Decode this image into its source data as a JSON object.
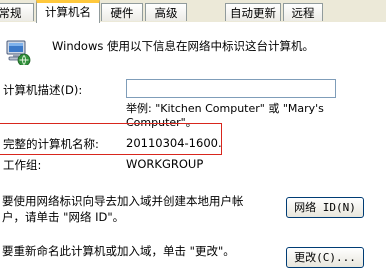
{
  "tabs": [
    {
      "label": "常规"
    },
    {
      "label": "计算机名"
    },
    {
      "label": "硬件"
    },
    {
      "label": "高级"
    },
    {
      "label": "自动更新"
    },
    {
      "label": "远程"
    }
  ],
  "icon": "computer-icon",
  "description": "Windows 使用以下信息在网络中标识这台计算机。",
  "computer_description": {
    "label": "计算机描述(D):",
    "value": "",
    "example_line1": "举例: \"Kitchen Computer\" 或 \"Mary's",
    "example_line2": "Computer\"。"
  },
  "full_name": {
    "label": "完整的计算机名称:",
    "value": "20110304-1600."
  },
  "workgroup": {
    "label": "工作组:",
    "value": "WORKGROUP"
  },
  "network_id": {
    "text_line1": "要使用网络标识向导去加入域并创建本地用户帐",
    "text_line2": "户，请单击 \"网络 ID\"。",
    "button": "网络 ID(N)"
  },
  "rename": {
    "text": "要重新命名此计算机或加入域，单击 \"更改\"。",
    "button": "更改(C)..."
  },
  "colors": {
    "highlight": "#d8261d",
    "active_tab_accent": "#ffc83c"
  }
}
